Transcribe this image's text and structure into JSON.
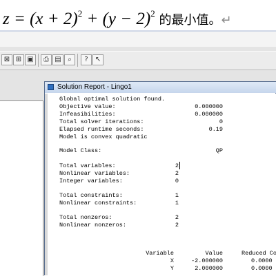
{
  "document": {
    "formula_prefix": "z = (x + 2)",
    "exp1": "2",
    "formula_mid": " + (y − 2)",
    "exp2": "2",
    "formula_tail": " 的最小值。",
    "return_mark": "↵"
  },
  "window": {
    "title": "Solution Report - Lingo1"
  },
  "report": {
    "status_line": "Global optimal solution found.",
    "rows": [
      {
        "label": "Objective value:",
        "value": "0.000000"
      },
      {
        "label": "Infeasibilities:",
        "value": "0.000000"
      },
      {
        "label": "Total solver iterations:",
        "value": "0"
      },
      {
        "label": "Elapsed runtime seconds:",
        "value": "0.19"
      }
    ],
    "model_note": "Model is convex quadratic",
    "model_class_label": "Model Class:",
    "model_class_value": "QP",
    "var_rows": [
      {
        "label": "Total variables:",
        "value": "2"
      },
      {
        "label": "Nonlinear variables:",
        "value": "2"
      },
      {
        "label": "Integer variables:",
        "value": "0"
      }
    ],
    "con_rows": [
      {
        "label": "Total constraints:",
        "value": "1"
      },
      {
        "label": "Nonlinear constraints:",
        "value": "1"
      }
    ],
    "nz_rows": [
      {
        "label": "Total nonzeros:",
        "value": "2"
      },
      {
        "label": "Nonlinear nonzeros:",
        "value": "2"
      }
    ],
    "table": {
      "headers": [
        "Variable",
        "Value",
        "Reduced Co"
      ],
      "rows": [
        [
          "X",
          "-2.000000",
          "0.0000"
        ],
        [
          "Y",
          "2.000000",
          "0.0000"
        ]
      ]
    }
  },
  "toolbar_icons": [
    "close-window-icon",
    "grid-x-icon",
    "image-icon",
    "print-preview-icon",
    "print-icon",
    "find-replace-icon",
    "help-icon",
    "context-help-icon"
  ]
}
